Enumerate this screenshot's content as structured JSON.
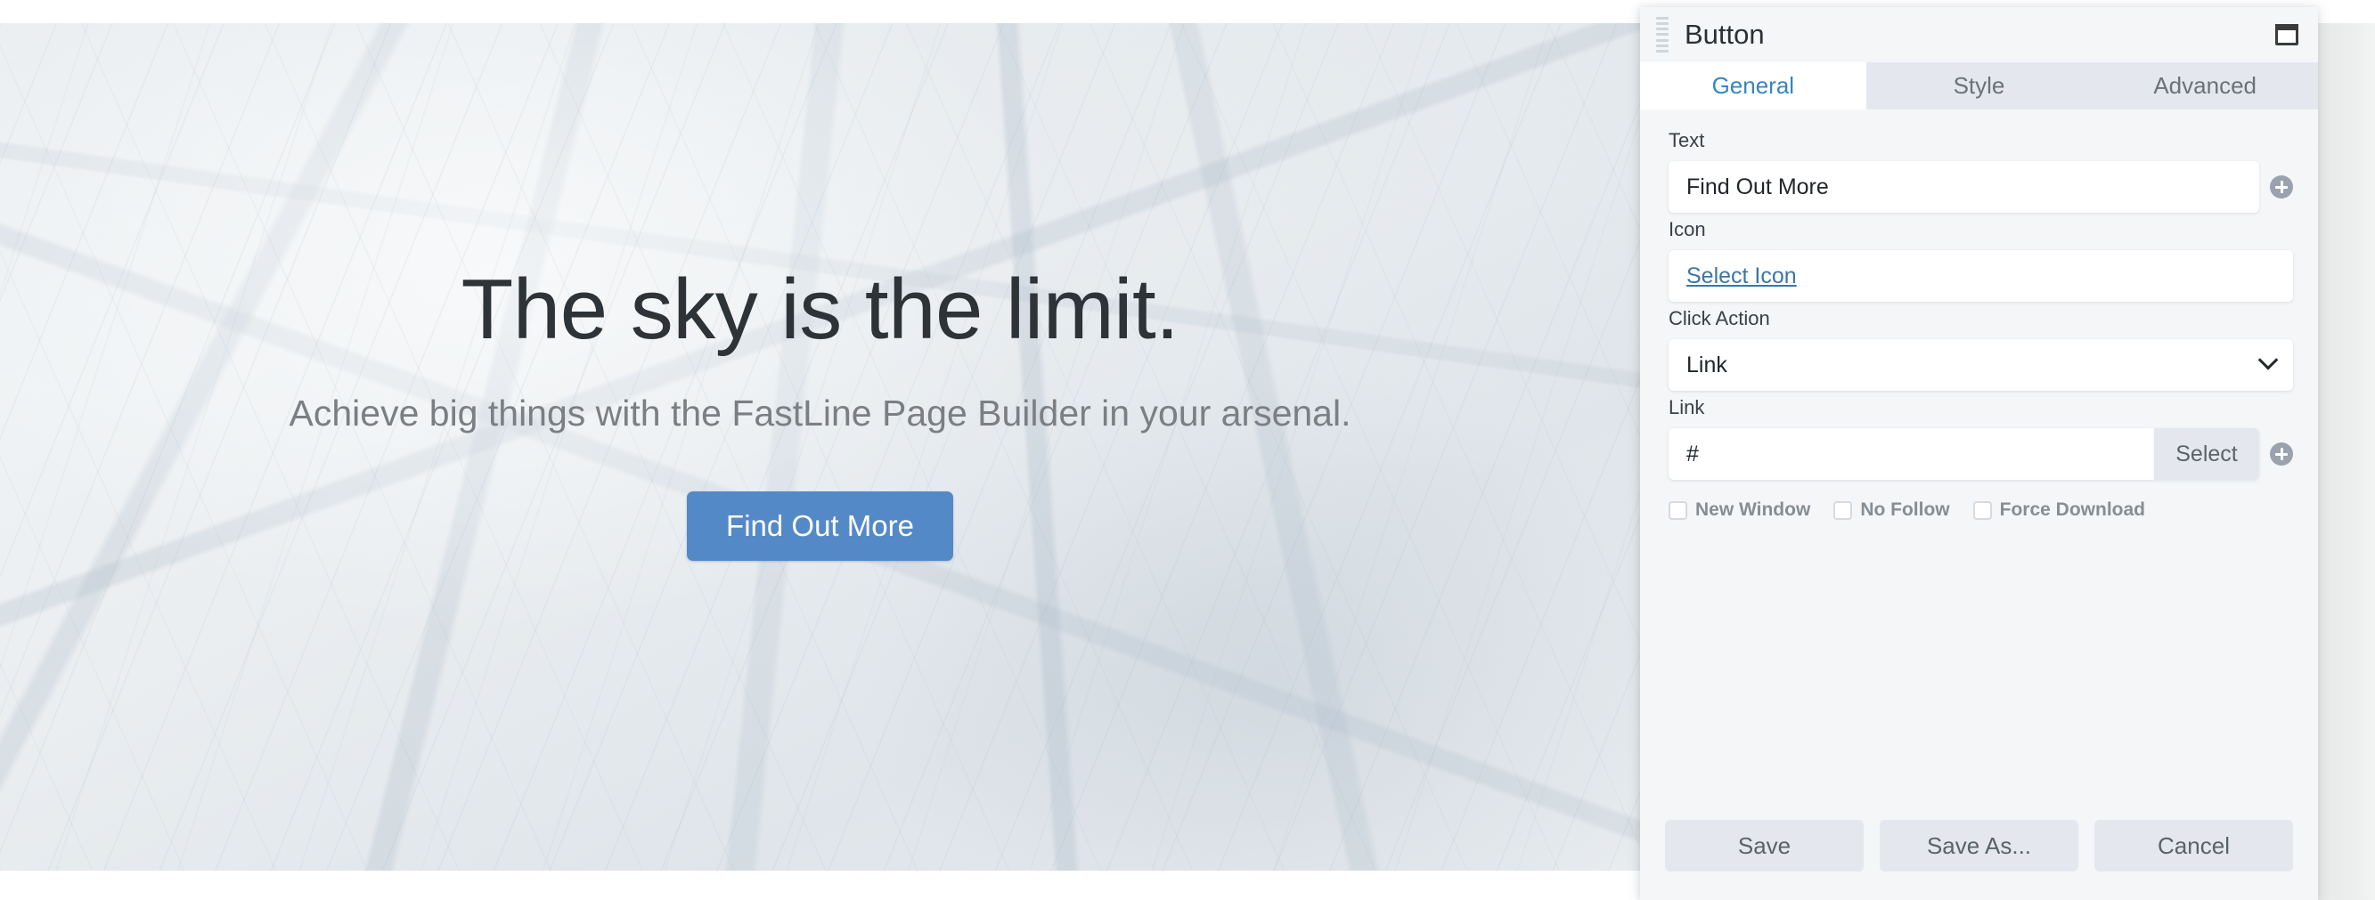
{
  "page": {
    "hero": {
      "title": "The sky is the limit.",
      "subtitle": "Achieve big things with the FastLine Page Builder in your arsenal.",
      "cta_label": "Find Out More",
      "cta_color": "#5489c7"
    }
  },
  "panel": {
    "title": "Button",
    "window_icon_name": "window-icon",
    "drag_handle_name": "drag-handle",
    "tabs": [
      {
        "label": "General",
        "active": true
      },
      {
        "label": "Style",
        "active": false
      },
      {
        "label": "Advanced",
        "active": false
      }
    ],
    "accent_color": "#3784c4",
    "fields": {
      "text": {
        "label": "Text",
        "value": "Find Out More",
        "placeholder": ""
      },
      "icon": {
        "label": "Icon",
        "link_label": "Select Icon"
      },
      "click_action": {
        "label": "Click Action",
        "value": "Link",
        "options": [
          "Link"
        ]
      },
      "link": {
        "label": "Link",
        "value": "#",
        "placeholder": "",
        "select_button": "Select"
      }
    },
    "checkboxes": [
      {
        "label": "New Window",
        "checked": false
      },
      {
        "label": "No Follow",
        "checked": false
      },
      {
        "label": "Force Download",
        "checked": false
      }
    ],
    "footer_buttons": [
      {
        "label": "Save"
      },
      {
        "label": "Save As..."
      },
      {
        "label": "Cancel"
      }
    ]
  }
}
